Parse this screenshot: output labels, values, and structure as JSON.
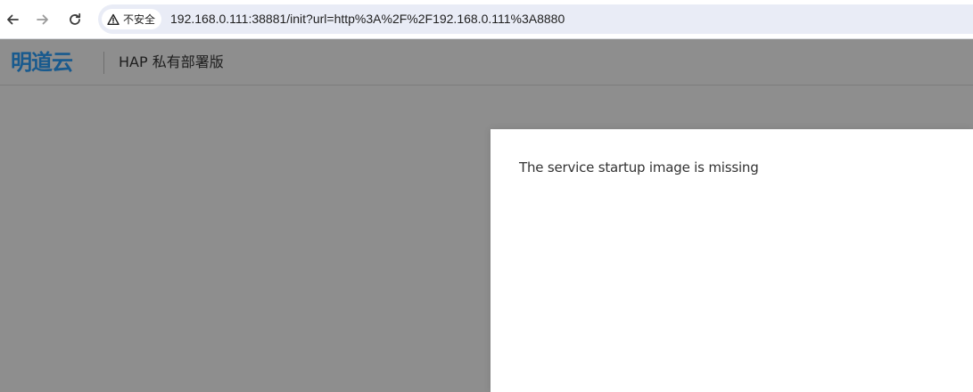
{
  "browser": {
    "back_icon": "arrow-left-icon",
    "forward_icon": "arrow-right-icon",
    "reload_icon": "reload-icon",
    "security_icon": "warning-triangle-icon",
    "security_label": "不安全",
    "url": "192.168.0.111:38881/init?url=http%3A%2F%2F192.168.0.111%3A8880"
  },
  "header": {
    "logo_text": "明道云",
    "product_name": "HAP 私有部署版"
  },
  "dialog": {
    "message": "The service startup image is missing"
  },
  "colors": {
    "logo": "#185a8e",
    "overlay": "#8e8e8e",
    "omnibox": "#e9ecf6"
  }
}
